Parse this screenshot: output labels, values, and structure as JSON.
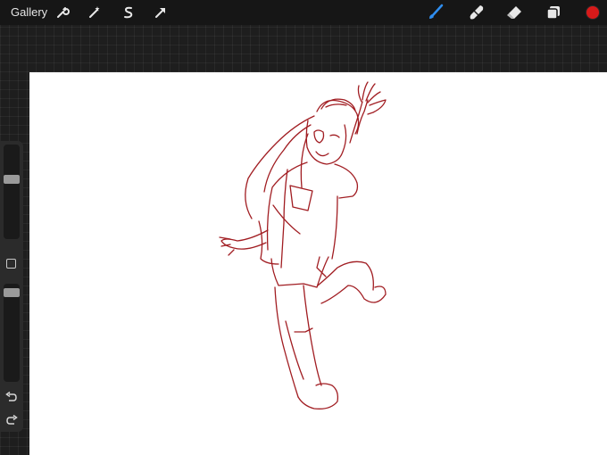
{
  "topbar": {
    "gallery_label": "Gallery",
    "left_tools": [
      {
        "name": "wrench-icon"
      },
      {
        "name": "magic-wand-icon"
      },
      {
        "name": "selection-s-icon"
      },
      {
        "name": "transform-arrow-icon"
      }
    ],
    "right_tools": [
      {
        "name": "brush-icon",
        "active": true
      },
      {
        "name": "smudge-icon",
        "active": false
      },
      {
        "name": "eraser-icon",
        "active": false
      },
      {
        "name": "layers-icon",
        "active": false
      }
    ],
    "current_color": "#d71a1a"
  },
  "sidebar": {
    "brush_size_level": 0.65,
    "opacity_level": 0.05,
    "buttons": [
      "square-modify-icon",
      "undo-icon",
      "redo-icon"
    ]
  },
  "canvas": {
    "background": "#ffffff",
    "stroke_color": "#a11d22",
    "content": "sketch-figure"
  },
  "colors": {
    "active_tool": "#2f8ef0",
    "icon": "#e8e8e8"
  }
}
